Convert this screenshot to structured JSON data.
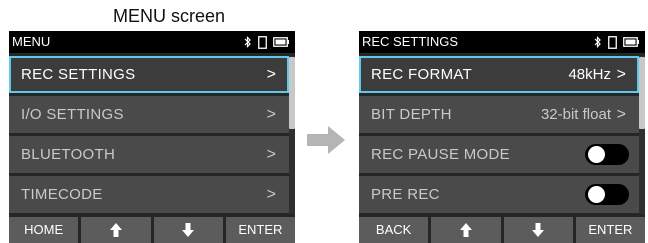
{
  "caption": "MENU screen",
  "left_screen": {
    "title": "MENU",
    "items": [
      {
        "label": "REC SETTINGS",
        "chevron": ">",
        "selected": true
      },
      {
        "label": "I/O SETTINGS",
        "chevron": ">"
      },
      {
        "label": "BLUETOOTH",
        "chevron": ">"
      },
      {
        "label": "TIMECODE",
        "chevron": ">"
      }
    ],
    "softkeys": {
      "k1": "HOME",
      "k2": "up-arrow-icon",
      "k3": "down-arrow-icon",
      "k4": "ENTER"
    }
  },
  "right_screen": {
    "title": "REC SETTINGS",
    "items": [
      {
        "label": "REC FORMAT",
        "value": "48kHz",
        "chevron": ">",
        "selected": true
      },
      {
        "label": "BIT DEPTH",
        "value": "32-bit float",
        "chevron": ">"
      },
      {
        "label": "REC PAUSE MODE",
        "toggle": "off"
      },
      {
        "label": "PRE REC",
        "toggle": "off"
      }
    ],
    "softkeys": {
      "k1": "BACK",
      "k2": "up-arrow-icon",
      "k3": "down-arrow-icon",
      "k4": "ENTER"
    }
  },
  "status_icons": [
    "bluetooth-icon",
    "sd-card-icon",
    "battery-icon"
  ],
  "transition_icon": "right-arrow-icon",
  "colors": {
    "screen_bg": "#262626",
    "row_bg": "#4a4a4a",
    "selected_border": "#5ec9e8",
    "softkey_bg": "#5c5c5c",
    "toggle_off": "#000000"
  }
}
